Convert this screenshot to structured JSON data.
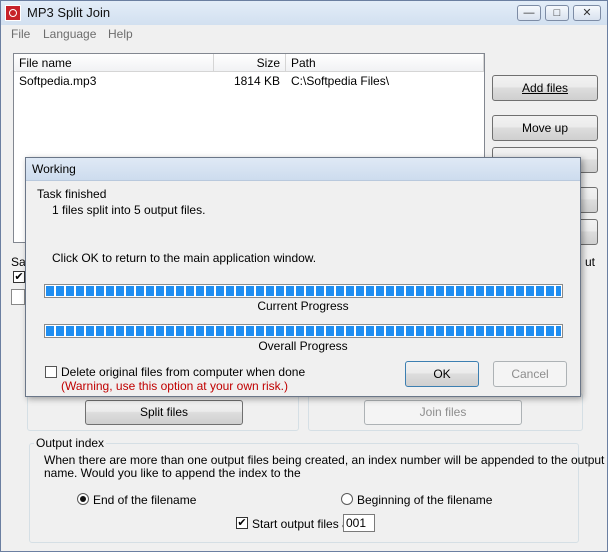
{
  "window": {
    "title": "MP3 Split Join",
    "controls": {
      "minimize": "—",
      "maximize": "□",
      "close": "✕"
    }
  },
  "menu": [
    "File",
    "Language",
    "Help"
  ],
  "file_list": {
    "columns": [
      "File name",
      "Size",
      "Path"
    ],
    "rows": [
      {
        "name": "Softpedia.mp3",
        "size": "1814 KB",
        "path": "C:\\Softpedia Files\\"
      }
    ]
  },
  "side_buttons": {
    "add_files": "Add files",
    "move_up": "Move up"
  },
  "background_fragments": {
    "save_label": "Sa",
    "right_label": "ut"
  },
  "split_button": "Split files",
  "join_button": "Join files",
  "output_index": {
    "legend": "Output index",
    "description_line1": "When there are more than one output files being created, an index number will be appended to the output file",
    "description_line2": "name. Would you like to append the index to the",
    "option_end": "End of the filename",
    "option_begin": "Beginning of the filename",
    "selected": "end",
    "start_label": "Start output files at",
    "start_checked": true,
    "start_value": "001"
  },
  "dialog": {
    "title": "Working",
    "status_heading": "Task finished",
    "status_detail": "1 files split into 5 output files.",
    "instruction": "Click OK to return to the main application window.",
    "current_label": "Current Progress",
    "current_progress": 1.0,
    "overall_label": "Overall Progress",
    "overall_progress": 1.0,
    "delete_label": "Delete original files from computer when done",
    "delete_checked": false,
    "warning": "(Warning, use this option at your own risk.)",
    "ok_label": "OK",
    "cancel_label": "Cancel"
  },
  "colors": {
    "progress_blue": "#1f8ef1",
    "warning_red": "#c00000"
  }
}
